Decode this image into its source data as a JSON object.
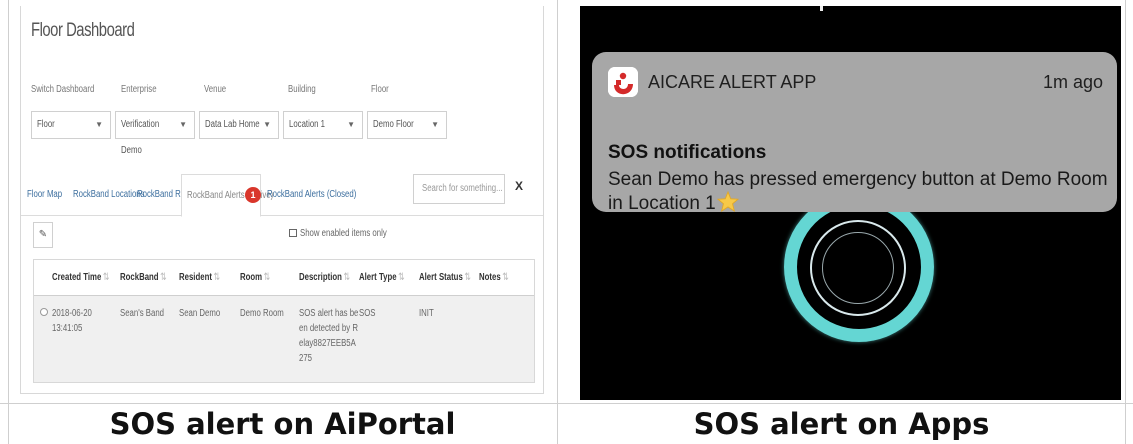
{
  "portal": {
    "title": "Floor Dashboard",
    "filters": [
      {
        "label": "Switch Dashboard",
        "value": "Floor"
      },
      {
        "label": "Enterprise",
        "value": "Verification Demo"
      },
      {
        "label": "Venue",
        "value": "Data Lab Home"
      },
      {
        "label": "Building",
        "value": "Location 1"
      },
      {
        "label": "Floor",
        "value": "Demo Floor"
      }
    ],
    "tabs": [
      {
        "label": "Floor Map"
      },
      {
        "label": "RockBand Locations"
      },
      {
        "label": "RockBand RSSIs"
      },
      {
        "label": "RockBand Alerts (Active)",
        "badge": "1"
      },
      {
        "label": "RockBand Alerts (Closed)"
      }
    ],
    "search": {
      "placeholder": "Search for something..."
    },
    "clear_label": "X",
    "edit_label": "✎",
    "show_enabled_label": "Show enabled items only",
    "table": {
      "headers": [
        "Created Time",
        "RockBand",
        "Resident",
        "Room",
        "Description",
        "Alert Type",
        "Alert Status",
        "Notes"
      ],
      "sort_glyph": "⇅",
      "row": {
        "created_time": "2018-06-20 13:41:05",
        "rockband": "Sean's Band",
        "resident": "Sean Demo",
        "room": "Demo Room",
        "description": "SOS alert has been detected by Relay8827EEB5A275",
        "alert_type": "SOS",
        "alert_status": "INIT",
        "notes": ""
      }
    }
  },
  "notification": {
    "app_name": "AICARE ALERT APP",
    "time": "1m ago",
    "title": "SOS notifications",
    "body": "Sean Demo has pressed emergency button at Demo Room in Location 1",
    "brand_color": "#d42a2a"
  },
  "captions": {
    "left": "SOS alert on AiPortal",
    "right": "SOS alert on Apps"
  },
  "colors": {
    "ring": "#64d6d3",
    "badge": "#d9362b",
    "tab_link": "#3c6e9e"
  }
}
